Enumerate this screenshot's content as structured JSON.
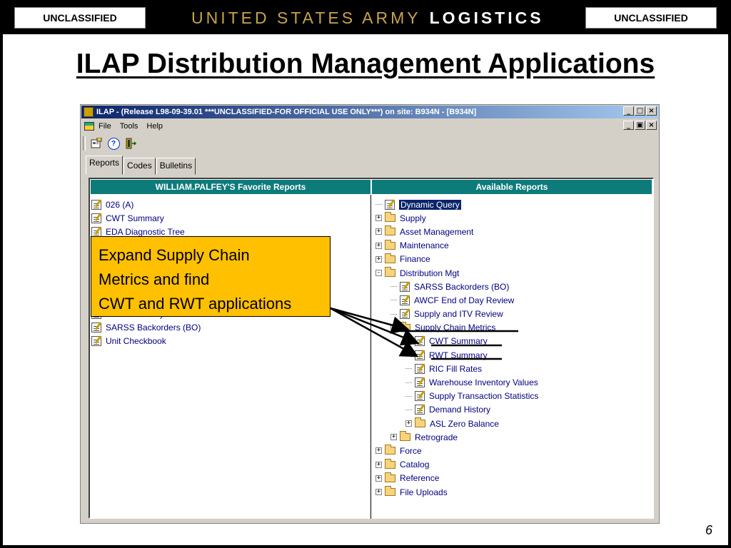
{
  "header": {
    "classification_left": "UNCLASSIFIED",
    "classification_right": "UNCLASSIFIED",
    "org_title_part1": "UNITED STATES ARMY",
    "org_title_part2": "LOGISTICS"
  },
  "slide": {
    "title": "ILAP Distribution Management Applications",
    "page_number": "6"
  },
  "window": {
    "title": "ILAP - (Release L98-09-39.01 ***UNCLASSIFIED-FOR OFFICIAL USE ONLY***) on site: B934N - [B934N]",
    "controls": [
      "_",
      "□",
      "×"
    ],
    "menu": [
      "File",
      "Tools",
      "Help"
    ],
    "mdi_controls": [
      "_",
      "▣",
      "×"
    ],
    "toolbar": [
      {
        "icon": "properties-icon"
      },
      {
        "icon": "help-icon",
        "glyph": "?"
      },
      {
        "icon": "exit-icon"
      }
    ],
    "tabs": [
      {
        "label": "Reports",
        "active": true
      },
      {
        "label": "Codes",
        "active": false
      },
      {
        "label": "Bulletins",
        "active": false
      }
    ]
  },
  "favorites": {
    "header": "WILLIAM.PALFEY'S Favorite Reports",
    "items": [
      "026 (A)",
      "CWT Summary",
      "EDA Diagnostic Tree",
      "",
      "",
      "",
      "",
      "",
      "RWT Summary",
      "SARSS Backorders (BO)",
      "Unit Checkbook"
    ]
  },
  "available": {
    "header": "Available Reports",
    "tree": [
      {
        "label": "Dynamic Query",
        "type": "report",
        "level": 0,
        "selected": true
      },
      {
        "label": "Supply",
        "type": "folder",
        "level": 0,
        "expander": "+"
      },
      {
        "label": "Asset Management",
        "type": "folder",
        "level": 0,
        "expander": "+"
      },
      {
        "label": "Maintenance",
        "type": "folder",
        "level": 0,
        "expander": "+"
      },
      {
        "label": "Finance",
        "type": "folder",
        "level": 0,
        "expander": "+"
      },
      {
        "label": "Distribution Mgt",
        "type": "folder",
        "level": 0,
        "expander": "-"
      },
      {
        "label": "SARSS Backorders (BO)",
        "type": "report",
        "level": 1
      },
      {
        "label": "AWCF End of Day Review",
        "type": "report",
        "level": 1
      },
      {
        "label": "Supply and ITV Review",
        "type": "report",
        "level": 1
      },
      {
        "label": "Supply Chain Metrics",
        "type": "folder",
        "level": 1,
        "expander": "-"
      },
      {
        "label": "CWT Summary",
        "type": "report",
        "level": 2
      },
      {
        "label": "RWT Summary",
        "type": "report",
        "level": 2
      },
      {
        "label": "RIC Fill Rates",
        "type": "report",
        "level": 2
      },
      {
        "label": "Warehouse Inventory Values",
        "type": "report",
        "level": 2
      },
      {
        "label": "Supply Transaction Statistics",
        "type": "report",
        "level": 2
      },
      {
        "label": "Demand History",
        "type": "report",
        "level": 2
      },
      {
        "label": "ASL Zero Balance",
        "type": "folder",
        "level": 2,
        "expander": "+"
      },
      {
        "label": "Retrograde",
        "type": "folder",
        "level": 1,
        "expander": "+"
      },
      {
        "label": "Force",
        "type": "folder",
        "level": 0,
        "expander": "+"
      },
      {
        "label": "Catalog",
        "type": "folder",
        "level": 0,
        "expander": "+"
      },
      {
        "label": "Reference",
        "type": "folder",
        "level": 0,
        "expander": "+"
      },
      {
        "label": "File Uploads",
        "type": "folder",
        "level": 0,
        "expander": "+"
      }
    ]
  },
  "callout": {
    "lines": [
      "Expand Supply Chain",
      "Metrics and find",
      "CWT and RWT applications"
    ]
  },
  "colors": {
    "header_gold": "#c8a44b",
    "callout_bg": "#ffc000",
    "column_header_bg": "#0e7b7b",
    "selection_bg": "#0a246a",
    "link_text": "#000080"
  }
}
